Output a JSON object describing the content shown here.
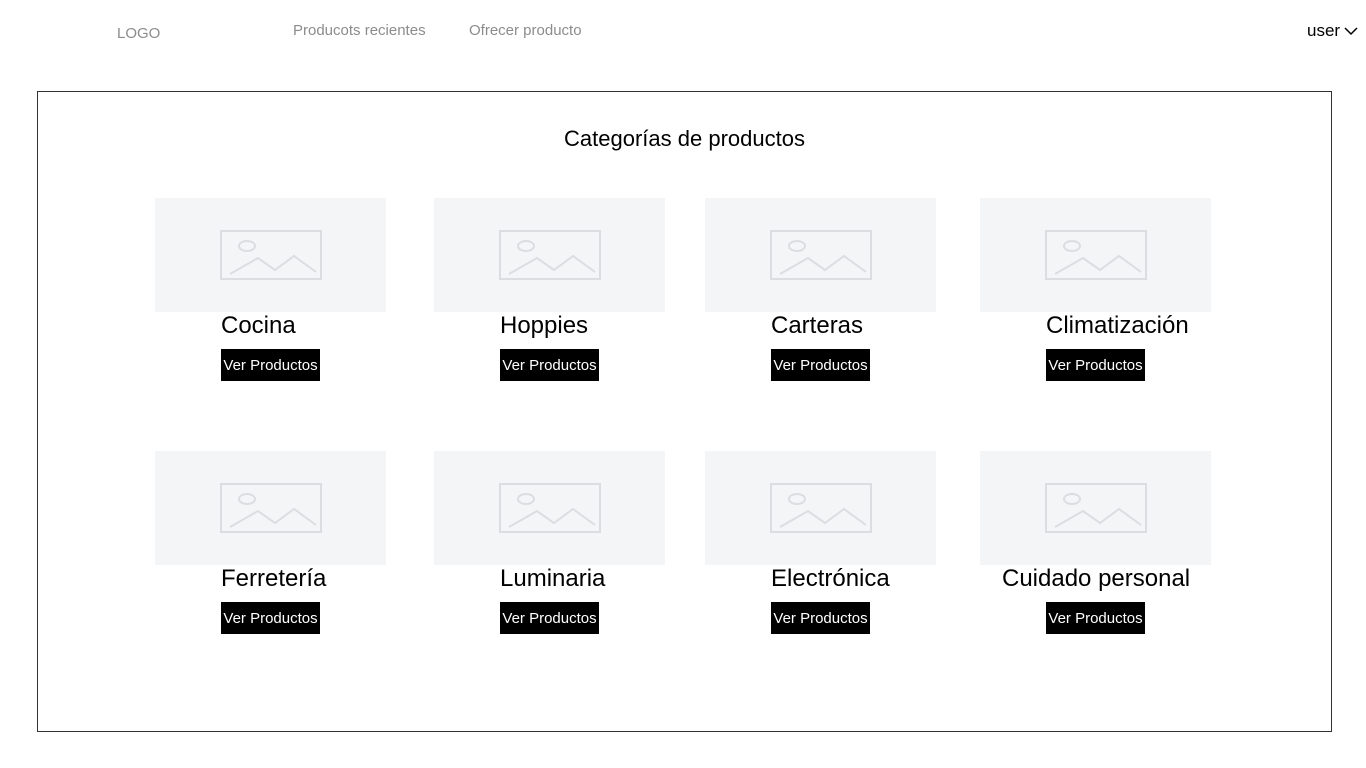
{
  "header": {
    "logo": "LOGO",
    "nav": {
      "recent": "Producots recientes",
      "offer": "Ofrecer producto"
    },
    "user": "user"
  },
  "main": {
    "title": "Categorías de productos",
    "categories": [
      {
        "name": "Cocina",
        "button": "Ver Productos"
      },
      {
        "name": "Hoppies",
        "button": "Ver Productos"
      },
      {
        "name": "Carteras",
        "button": "Ver Productos"
      },
      {
        "name": "Climatización",
        "button": "Ver Productos"
      },
      {
        "name": "Ferretería",
        "button": "Ver Productos"
      },
      {
        "name": "Luminaria",
        "button": "Ver Productos"
      },
      {
        "name": "Electrónica",
        "button": "Ver Productos"
      },
      {
        "name": "Cuidado personal",
        "button": "Ver Productos"
      }
    ]
  },
  "icons": {
    "image_placeholder": "image-placeholder-icon",
    "user_dropdown": "chevron-down-icon"
  },
  "colors": {
    "button_bg": "#000000",
    "button_text": "#ffffff",
    "placeholder_bg": "#f4f5f7",
    "nav_text": "#8c8c8c"
  }
}
